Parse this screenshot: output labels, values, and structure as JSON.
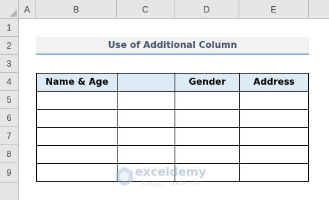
{
  "columns": [
    "A",
    "B",
    "C",
    "D",
    "E"
  ],
  "rows": [
    "1",
    "2",
    "3",
    "4",
    "5",
    "6",
    "7",
    "8",
    "9"
  ],
  "title": "Use of Additional Column",
  "table": {
    "headers": [
      "Name & Age",
      "",
      "Gender",
      "Address"
    ]
  },
  "watermark": {
    "name": "exceldemy",
    "tagline": "EXCEL · DATA · BI"
  },
  "colors": {
    "header_fill": "#ddebf7",
    "title_underline": "#8eaadb",
    "title_text": "#44546a"
  }
}
